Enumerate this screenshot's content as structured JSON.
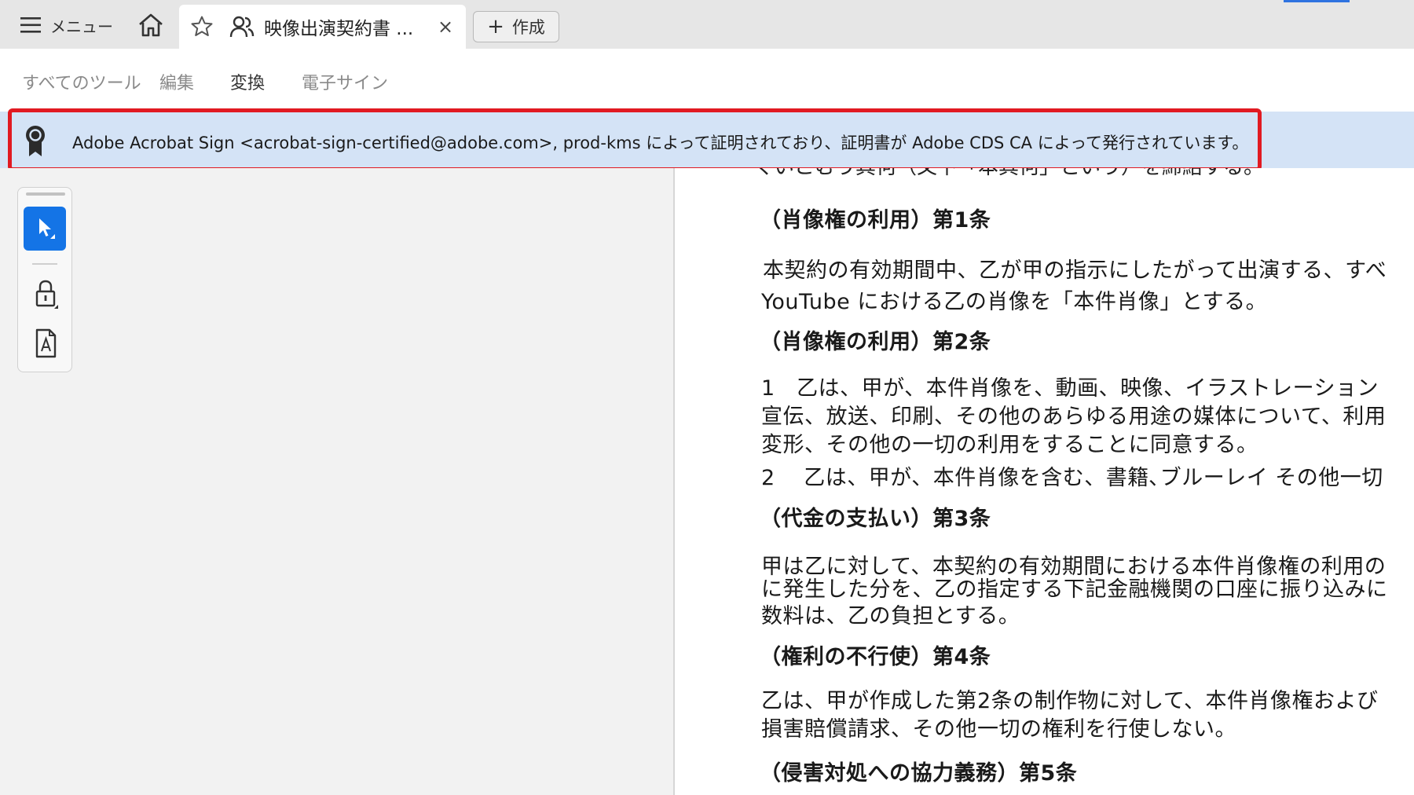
{
  "topbar": {
    "menu_label": "メニュー",
    "active_tab_title": "映像出演契約書 ...",
    "close_symbol": "×",
    "create_label": "作成",
    "accent_color": "#2f73e0"
  },
  "tools": {
    "tabs": [
      "すべてのツール",
      "編集",
      "変換",
      "電子サイン"
    ],
    "active": "変換"
  },
  "certificate": {
    "text": "Adobe Acrobat Sign <acrobat-sign-certified@adobe.com>, prod-kms によって証明されており、証明書が Adobe CDS CA によって発行されています。",
    "highlight_color": "#e11a22",
    "banner_color": "#d4e3f6"
  },
  "palette": {
    "tools": [
      "select-tool-icon",
      "lock-icon",
      "pdf-icon"
    ],
    "active_color": "#1474e6"
  },
  "document": {
    "cut_line": "くいこむう其何（又下「本其何」という）を締結する。",
    "lines": [
      "（肖像権の利用）第1条",
      "本契約の有効期間中、乙が甲の指示にしたがって出演する、すべ",
      "YouTube における乙の肖像を「本件肖像」とする。",
      "（肖像権の利用）第2条",
      "1　乙は、甲が、本件肖像を、動画、映像、イラストレーション",
      "宣伝、放送、印刷、その他のあらゆる用途の媒体について、利用",
      "変形、その他の一切の利用をすることに同意する。",
      "2　 乙は、甲が、本件肖像を含む、書籍､ブルーレイ その他一切",
      "（代金の支払い）第3条",
      "甲は乙に対して、本契約の有効期間における本件肖像権の利用の",
      "に発生した分を、乙の指定する下記金融機関の口座に振り込みに",
      "数料は、乙の負担とする。",
      "（権利の不行使）第4条",
      "乙は、甲が作成した第2条の制作物に対して、本件肖像権および",
      "損害賠償請求、その他一切の権利を行使しない。",
      "（侵害対処への協力義務）第5条"
    ]
  }
}
